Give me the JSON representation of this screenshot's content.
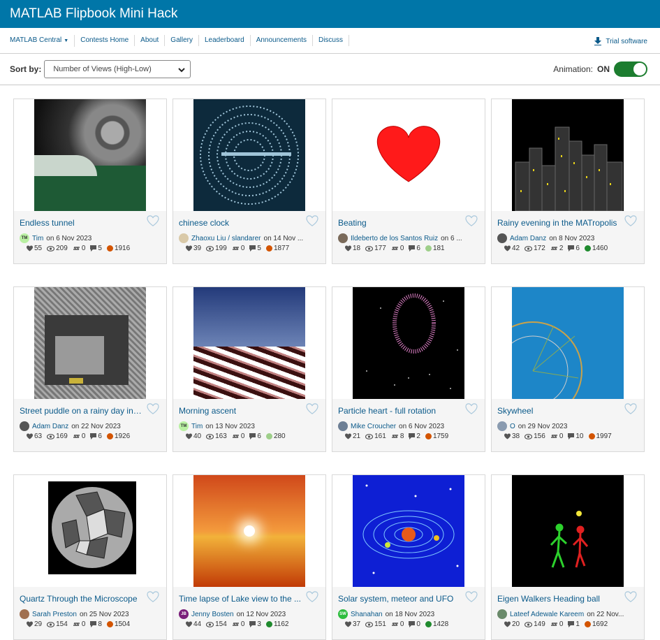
{
  "header": {
    "title": "MATLAB Flipbook Mini Hack"
  },
  "nav": {
    "items": [
      "MATLAB Central",
      "Contests Home",
      "About",
      "Gallery",
      "Leaderboard",
      "Announcements",
      "Discuss"
    ],
    "trial": "Trial software"
  },
  "toolbar": {
    "sort_label": "Sort by:",
    "sort_value": "Number of Views (High-Low)",
    "anim_label": "Animation:",
    "anim_state": "ON"
  },
  "colors": {
    "brand": "#0076a8",
    "link": "#0b5a8a",
    "toggle": "#1c7d2f"
  },
  "cards": [
    {
      "title": "Endless tunnel",
      "author": "Tim",
      "date": " on 6 Nov 2023",
      "likes": "55",
      "views": "209",
      "remixes": "0",
      "comments": "5",
      "score": "1916",
      "avatar": "TM",
      "avatar_color": "#b9f0a2",
      "score_color": "#d35400"
    },
    {
      "title": "chinese clock",
      "author": "Zhaoxu Liu / slandarer",
      "date": " on 14 Nov ...",
      "likes": "39",
      "views": "199",
      "remixes": "0",
      "comments": "5",
      "score": "1877",
      "avatar": "",
      "avatar_color": "#d9c9a8",
      "score_color": "#d35400"
    },
    {
      "title": "Beating",
      "author": "Ildeberto de los Santos Ruiz",
      "date": " on 6 ...",
      "likes": "18",
      "views": "177",
      "remixes": "0",
      "comments": "6",
      "score": "181",
      "avatar": "",
      "avatar_color": "#7a6a5a",
      "score_color": "#9ecf8a"
    },
    {
      "title": "Rainy evening in the MATropolis",
      "author": "Adam Danz",
      "date": " on 8 Nov 2023",
      "likes": "42",
      "views": "172",
      "remixes": "2",
      "comments": "6",
      "score": "1460",
      "avatar": "",
      "avatar_color": "#555555",
      "score_color": "#1f8a2e"
    },
    {
      "title": "Street puddle on a rainy day in t...",
      "author": "Adam Danz",
      "date": " on 22 Nov 2023",
      "likes": "63",
      "views": "169",
      "remixes": "0",
      "comments": "6",
      "score": "1926",
      "avatar": "",
      "avatar_color": "#555555",
      "score_color": "#d35400"
    },
    {
      "title": "Morning ascent",
      "author": "Tim",
      "date": " on 13 Nov 2023",
      "likes": "40",
      "views": "163",
      "remixes": "0",
      "comments": "6",
      "score": "280",
      "avatar": "TM",
      "avatar_color": "#b9f0a2",
      "score_color": "#9ecf8a"
    },
    {
      "title": "Particle heart - full rotation",
      "author": "Mike Croucher",
      "date": " on 6 Nov 2023",
      "likes": "21",
      "views": "161",
      "remixes": "8",
      "comments": "2",
      "score": "1759",
      "avatar": "",
      "avatar_color": "#6d7f95",
      "score_color": "#d35400"
    },
    {
      "title": "Skywheel",
      "author": "O",
      "date": " on 29 Nov 2023",
      "likes": "38",
      "views": "156",
      "remixes": "0",
      "comments": "10",
      "score": "1997",
      "avatar": "",
      "avatar_color": "#8a9bb0",
      "score_color": "#d35400"
    },
    {
      "title": "Quartz Through the Microscope",
      "author": "Sarah Preston",
      "date": " on 25 Nov 2023",
      "likes": "29",
      "views": "154",
      "remixes": "0",
      "comments": "8",
      "score": "1504",
      "avatar": "",
      "avatar_color": "#a07050",
      "score_color": "#d35400"
    },
    {
      "title": "Time lapse of Lake view to the ...",
      "author": "Jenny Bosten",
      "date": " on 12 Nov 2023",
      "likes": "44",
      "views": "154",
      "remixes": "0",
      "comments": "3",
      "score": "1162",
      "avatar": "JB",
      "avatar_color": "#7a1e7a",
      "score_color": "#1f8a2e"
    },
    {
      "title": "Solar system, meteor and UFO",
      "author": "Shanahan",
      "date": " on 18 Nov 2023",
      "likes": "37",
      "views": "151",
      "remixes": "0",
      "comments": "0",
      "score": "1428",
      "avatar": "SW",
      "avatar_color": "#2ebd3e",
      "score_color": "#1f8a2e"
    },
    {
      "title": "Eigen Walkers Heading ball",
      "author": "Lateef Adewale Kareem",
      "date": " on 22 Nov...",
      "likes": "20",
      "views": "149",
      "remixes": "0",
      "comments": "1",
      "score": "1692",
      "avatar": "",
      "avatar_color": "#6a8a6a",
      "score_color": "#d35400"
    }
  ]
}
